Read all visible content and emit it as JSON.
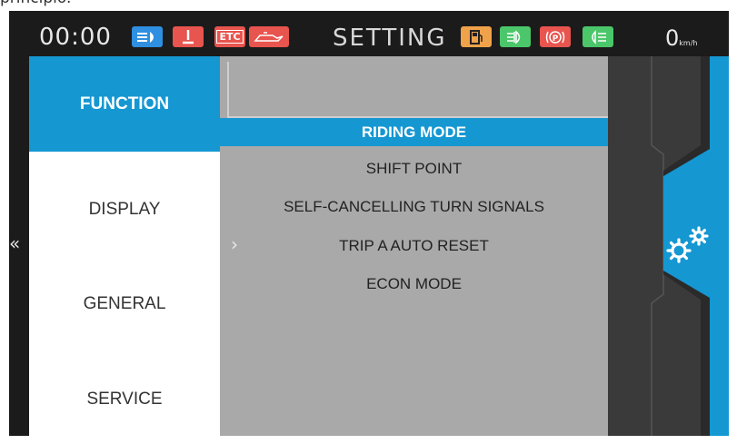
{
  "caption": "principio.",
  "status_bar": {
    "clock": "00:00",
    "title": "SETTING",
    "speed_value": "0",
    "speed_unit": "km/h",
    "indicators": [
      {
        "icon": "headlight-icon",
        "color": "#2f8fe0"
      },
      {
        "icon": "warning-icon",
        "color": "#e8544e"
      },
      {
        "icon": "etc-icon",
        "label": "ETC",
        "color": "#e8544e"
      },
      {
        "icon": "oil-warning-icon",
        "color": "#e8544e"
      },
      {
        "icon": "fuel-icon",
        "color": "#f0a24a"
      },
      {
        "icon": "fog-light-icon",
        "color": "#4bc66a"
      },
      {
        "icon": "parking-brake-icon",
        "color": "#e8544e"
      },
      {
        "icon": "position-light-icon",
        "color": "#4bc66a"
      }
    ]
  },
  "menu": {
    "items": [
      {
        "label": "FUNCTION",
        "active": true
      },
      {
        "label": "DISPLAY",
        "active": false
      },
      {
        "label": "GENERAL",
        "active": false
      },
      {
        "label": "SERVICE",
        "active": false
      }
    ]
  },
  "submenu": {
    "items": [
      {
        "label": "RIDING MODE",
        "active": true
      },
      {
        "label": "SHIFT POINT",
        "active": false
      },
      {
        "label": "SELF-CANCELLING TURN SIGNALS",
        "active": false
      },
      {
        "label": "TRIP A AUTO RESET",
        "active": false
      },
      {
        "label": "ECON MODE",
        "active": false
      }
    ]
  },
  "nav": {
    "back_symbol": "«",
    "forward_symbol": "›"
  },
  "colors": {
    "accent": "#1597d2",
    "screen_bg": "#1b1b1b",
    "content_bg": "#a9a9a9"
  }
}
